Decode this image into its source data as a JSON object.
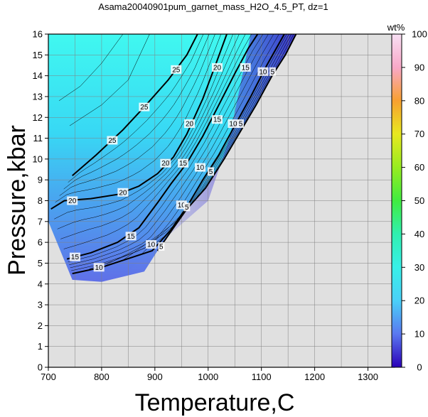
{
  "chart_data": {
    "type": "contour",
    "title": "Asama20040901pum_garnet_mass_H2O_4.5_PT, dz=1",
    "xlabel": "Temperature,C",
    "ylabel": "Pressure,kbar",
    "xlim": [
      700,
      1350
    ],
    "ylim": [
      0,
      16
    ],
    "x_ticks": [
      700,
      800,
      900,
      1000,
      1100,
      1200,
      1300
    ],
    "y_ticks": [
      0,
      1,
      2,
      3,
      4,
      5,
      6,
      7,
      8,
      9,
      10,
      11,
      12,
      13,
      14,
      15,
      16
    ],
    "grid": true,
    "background_color": "#e0e0e0",
    "colorbar": {
      "unit": "wt%",
      "range": [
        0,
        100
      ],
      "ticks": [
        0,
        10,
        20,
        30,
        40,
        50,
        60,
        70,
        80,
        90,
        100
      ],
      "stops": [
        {
          "v": 0,
          "c": "#2a00b8"
        },
        {
          "v": 10,
          "c": "#5a78f0"
        },
        {
          "v": 20,
          "c": "#4ad0f8"
        },
        {
          "v": 30,
          "c": "#38f0e8"
        },
        {
          "v": 40,
          "c": "#30f0b0"
        },
        {
          "v": 50,
          "c": "#40ec40"
        },
        {
          "v": 60,
          "c": "#98ec20"
        },
        {
          "v": 70,
          "c": "#e8e820"
        },
        {
          "v": 80,
          "c": "#f8a030"
        },
        {
          "v": 90,
          "c": "#f8a8c8"
        },
        {
          "v": 100,
          "c": "#f8e0f4"
        }
      ]
    },
    "major_contours": [
      {
        "level": 25,
        "points": [
          [
            745,
            9.2
          ],
          [
            790,
            10.2
          ],
          [
            840,
            11.4
          ],
          [
            880,
            12.5
          ],
          [
            925,
            13.8
          ],
          [
            960,
            15.0
          ],
          [
            980,
            16.0
          ]
        ]
      },
      {
        "level": 20,
        "points": [
          [
            705,
            7.6
          ],
          [
            730,
            8.0
          ],
          [
            780,
            8.1
          ],
          [
            830,
            8.3
          ],
          [
            870,
            8.7
          ],
          [
            905,
            9.3
          ],
          [
            935,
            10.1
          ],
          [
            960,
            11.2
          ],
          [
            990,
            12.9
          ],
          [
            1015,
            14.6
          ],
          [
            1035,
            16.0
          ]
        ]
      },
      {
        "level": 15,
        "points": [
          [
            735,
            5.2
          ],
          [
            780,
            5.5
          ],
          [
            830,
            6.0
          ],
          [
            870,
            6.7
          ],
          [
            905,
            7.9
          ],
          [
            930,
            8.8
          ],
          [
            960,
            9.8
          ],
          [
            990,
            11.1
          ],
          [
            1020,
            12.6
          ],
          [
            1050,
            14.1
          ],
          [
            1075,
            15.3
          ],
          [
            1093,
            16.0
          ]
        ]
      },
      {
        "level": 10,
        "points": [
          [
            745,
            4.5
          ],
          [
            800,
            4.8
          ],
          [
            860,
            5.3
          ],
          [
            895,
            5.6
          ],
          [
            930,
            6.6
          ],
          [
            960,
            7.7
          ],
          [
            990,
            9.0
          ],
          [
            1020,
            10.2
          ],
          [
            1050,
            11.6
          ],
          [
            1080,
            13.0
          ],
          [
            1110,
            14.5
          ],
          [
            1143,
            16.0
          ]
        ]
      },
      {
        "level": 5,
        "points": [
          [
            905,
            5.6
          ],
          [
            935,
            6.7
          ],
          [
            960,
            7.6
          ],
          [
            995,
            8.6
          ],
          [
            1030,
            10.0
          ],
          [
            1060,
            11.3
          ],
          [
            1090,
            12.6
          ],
          [
            1120,
            14.0
          ],
          [
            1145,
            15.0
          ],
          [
            1165,
            16.0
          ]
        ]
      }
    ],
    "contour_labels": [
      {
        "text": "25",
        "x": 820,
        "y": 10.9
      },
      {
        "text": "25",
        "x": 880,
        "y": 12.5
      },
      {
        "text": "25",
        "x": 940,
        "y": 14.3
      },
      {
        "text": "20",
        "x": 745,
        "y": 8.0
      },
      {
        "text": "20",
        "x": 840,
        "y": 8.4
      },
      {
        "text": "20",
        "x": 920,
        "y": 9.8
      },
      {
        "text": "20",
        "x": 965,
        "y": 11.7
      },
      {
        "text": "20",
        "x": 1017,
        "y": 14.4
      },
      {
        "text": "15",
        "x": 750,
        "y": 5.3
      },
      {
        "text": "15",
        "x": 855,
        "y": 6.3
      },
      {
        "text": "15",
        "x": 953,
        "y": 9.8
      },
      {
        "text": "15",
        "x": 1017,
        "y": 11.9
      },
      {
        "text": "15",
        "x": 1070,
        "y": 14.4
      },
      {
        "text": "10",
        "x": 795,
        "y": 4.8
      },
      {
        "text": "10",
        "x": 893,
        "y": 5.9
      },
      {
        "text": "10",
        "x": 950,
        "y": 7.8
      },
      {
        "text": "10",
        "x": 985,
        "y": 9.6
      },
      {
        "text": "10",
        "x": 1047,
        "y": 11.7
      },
      {
        "text": "10",
        "x": 1103,
        "y": 14.2
      },
      {
        "text": "5",
        "x": 912,
        "y": 5.8
      },
      {
        "text": "5",
        "x": 960,
        "y": 7.7
      },
      {
        "text": "5",
        "x": 1005,
        "y": 9.4
      },
      {
        "text": "5",
        "x": 1061,
        "y": 11.7
      },
      {
        "text": "5",
        "x": 1121,
        "y": 14.2
      }
    ]
  }
}
